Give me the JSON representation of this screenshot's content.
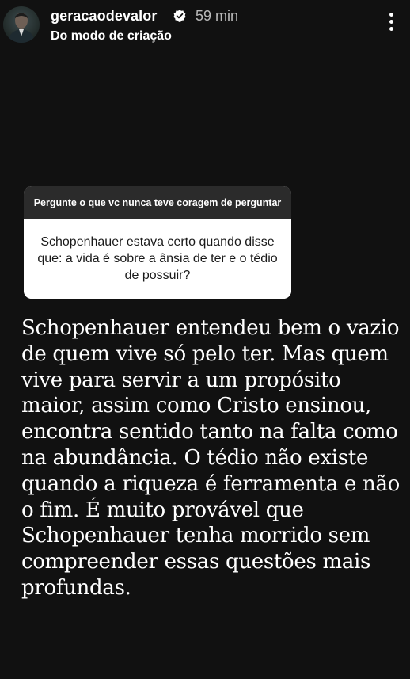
{
  "header": {
    "username": "geracaodevalor",
    "time": "59 min",
    "subtitle": "Do modo de criação",
    "verified_icon": "verified-badge-icon",
    "more_icon": "more-vertical-icon"
  },
  "question": {
    "prompt": "Pergunte o que vc nunca teve coragem de perguntar",
    "text": "Schopenhauer estava certo quando disse que: a vida é sobre a ânsia de ter e o tédio de possuir?"
  },
  "answer": {
    "text": "Schopenhauer entendeu bem o vazio de quem vive só pelo ter. Mas quem vive para servir a um propósito maior, assim como Cristo ensinou, encontra sentido tanto na falta como na abundância. O tédio não existe quando a riqueza é ferramenta e não o fim. É muito provável que Schopenhauer tenha morrido sem compreender essas questões mais profundas."
  },
  "colors": {
    "background": "#111111",
    "card_header": "#2b2b2b",
    "card_body": "#ffffff",
    "verified": "#ffffff",
    "time": "#b9b9b9"
  }
}
